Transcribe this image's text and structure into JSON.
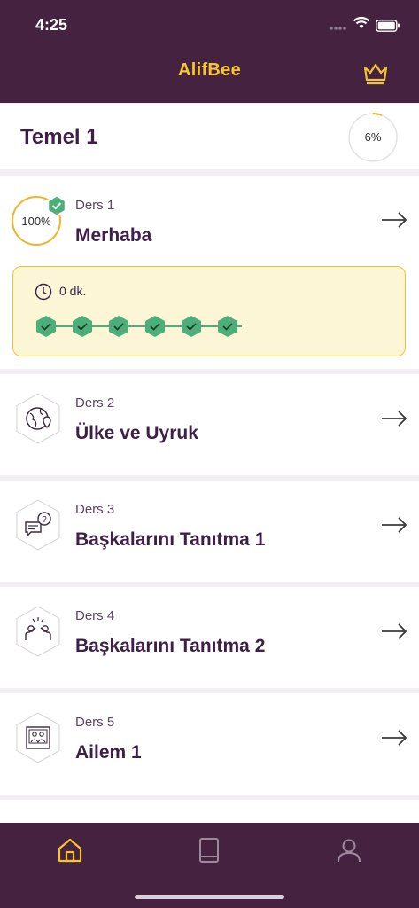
{
  "status_bar": {
    "time": "4:25"
  },
  "app": {
    "logo": "AlifBee",
    "premium_icon": "crown-icon"
  },
  "course": {
    "title": "Temel 1",
    "progress_text": "6%",
    "progress": 0.06
  },
  "lessons": [
    {
      "number": "Ders 1",
      "title": "Merhaba",
      "progress_text": "100%",
      "completed": true,
      "duration": "0 dk.",
      "steps_completed": 6,
      "icon": "check-badge-icon"
    },
    {
      "number": "Ders 2",
      "title": "Ülke ve Uyruk",
      "icon": "globe-location-icon"
    },
    {
      "number": "Ders 3",
      "title": "Başkalarını Tanıtma 1",
      "icon": "chat-question-icon"
    },
    {
      "number": "Ders 4",
      "title": "Başkalarını Tanıtma 2",
      "icon": "people-greeting-icon"
    },
    {
      "number": "Ders 5",
      "title": "Ailem 1",
      "icon": "family-photo-icon"
    }
  ],
  "bottom_nav": [
    {
      "name": "home",
      "icon": "home-icon",
      "active": true
    },
    {
      "name": "book",
      "icon": "book-icon",
      "active": false
    },
    {
      "name": "profile",
      "icon": "user-icon",
      "active": false
    }
  ],
  "colors": {
    "brand": "#45223f",
    "accent": "#f4c531",
    "success": "#4caf7a",
    "highlight_bg": "#fdf6d6"
  }
}
